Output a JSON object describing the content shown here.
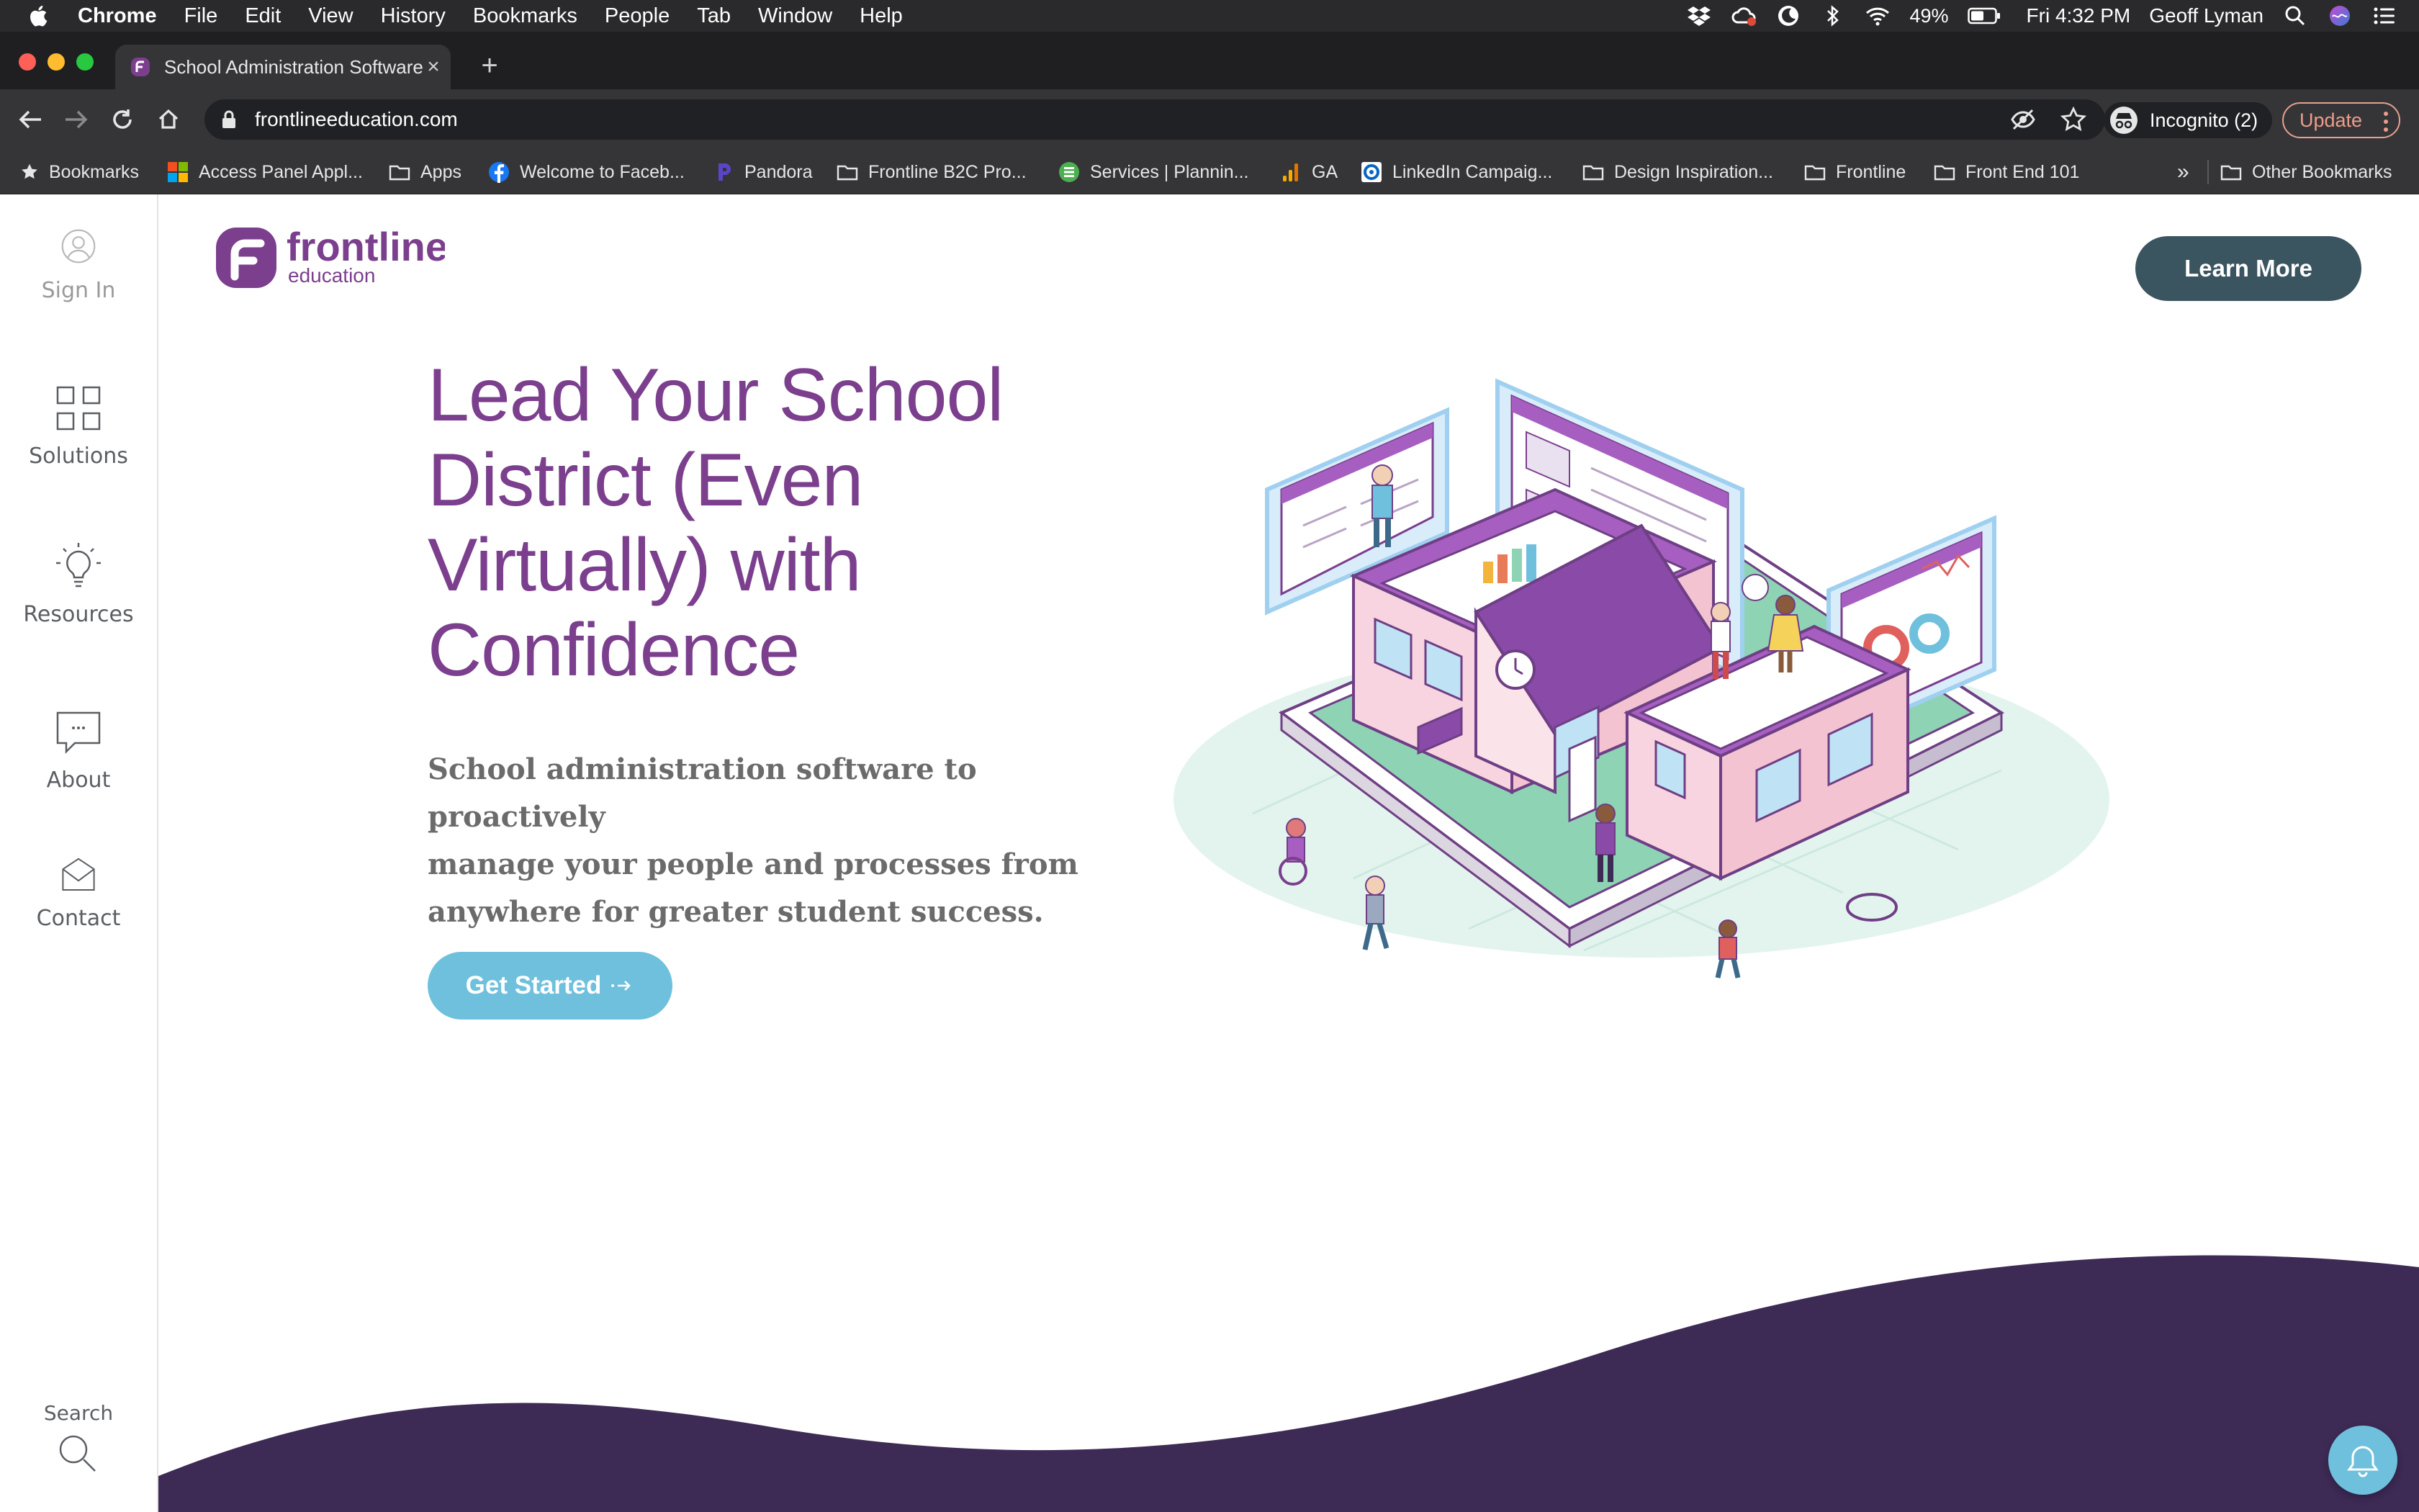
{
  "menubar": {
    "app": "Chrome",
    "items": [
      "File",
      "Edit",
      "View",
      "History",
      "Bookmarks",
      "People",
      "Tab",
      "Window",
      "Help"
    ],
    "battery": "49%",
    "clock": "Fri 4:32 PM",
    "user": "Geoff Lyman"
  },
  "tab": {
    "title": "School Administration Software",
    "new_tab_label": "+"
  },
  "toolbar": {
    "url": "frontlineeducation.com",
    "incognito_label": "Incognito (2)",
    "update_label": "Update"
  },
  "bookmarks": {
    "items": [
      {
        "label": "Bookmarks",
        "icon": "star-icon"
      },
      {
        "label": "Access Panel Appl...",
        "icon": "microsoft-icon"
      },
      {
        "label": "Apps",
        "icon": "folder-icon"
      },
      {
        "label": "Welcome to Faceb...",
        "icon": "facebook-icon"
      },
      {
        "label": "Pandora",
        "icon": "pandora-icon"
      },
      {
        "label": "Frontline B2C Pro...",
        "icon": "folder-icon"
      },
      {
        "label": "Services | Plannin...",
        "icon": "sheets-icon"
      },
      {
        "label": "GA",
        "icon": "analytics-icon"
      },
      {
        "label": "LinkedIn Campaig...",
        "icon": "linkedin-icon"
      },
      {
        "label": "Design Inspiration...",
        "icon": "folder-icon"
      },
      {
        "label": "Frontline",
        "icon": "folder-icon"
      },
      {
        "label": "Front End 101",
        "icon": "folder-icon"
      }
    ],
    "overflow": "»",
    "other": "Other Bookmarks"
  },
  "sidenav": {
    "sign_in": "Sign In",
    "solutions": "Solutions",
    "resources": "Resources",
    "about": "About",
    "contact": "Contact",
    "search": "Search"
  },
  "hero": {
    "headline_lines": [
      "Lead Your School",
      "District (Even",
      "Virtually) with",
      "Confidence"
    ],
    "subhead_lines": [
      "School administration software to proactively",
      "manage your people and processes from",
      "anywhere for greater student success."
    ],
    "cta": "Get Started",
    "learn_more": "Learn More"
  },
  "logo": {
    "word": "frontline",
    "sub": "education"
  },
  "colors": {
    "brand_purple": "#7b3f8e",
    "cta_blue": "#6fc0dc",
    "learn_more_bg": "#3a5460",
    "wave": "#3d2a55"
  }
}
